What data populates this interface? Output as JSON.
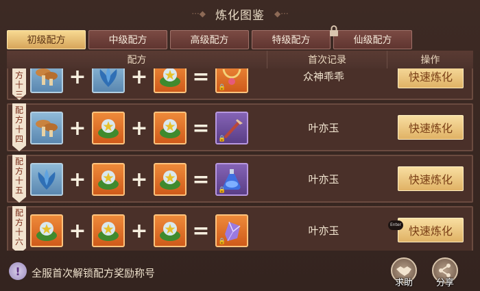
{
  "title": "炼化图鉴",
  "tabs": [
    {
      "label": "初级配方",
      "active": true,
      "locked": false
    },
    {
      "label": "中级配方",
      "active": false,
      "locked": false
    },
    {
      "label": "高级配方",
      "active": false,
      "locked": false
    },
    {
      "label": "特级配方",
      "active": false,
      "locked": false
    },
    {
      "label": "仙级配方",
      "active": false,
      "locked": true
    }
  ],
  "columns": {
    "recipe": "配方",
    "first_record": "首次记录",
    "action": "操作"
  },
  "rows": [
    {
      "ribbon": [
        "方",
        "十",
        "三"
      ],
      "items": [
        "mushroom",
        "blue-flower",
        "star-herb"
      ],
      "result": "gold-necklace",
      "record": "众神乖乖",
      "button": "快速炼化"
    },
    {
      "ribbon": [
        "配",
        "方",
        "十",
        "四"
      ],
      "items": [
        "mushroom",
        "star-herb",
        "star-herb"
      ],
      "result": "purple-weapon",
      "record": "叶亦玉",
      "button": "快速炼化"
    },
    {
      "ribbon": [
        "配",
        "方",
        "十",
        "五"
      ],
      "items": [
        "blue-flower",
        "star-herb",
        "star-herb"
      ],
      "result": "blue-potion",
      "record": "叶亦玉",
      "button": "快速炼化"
    },
    {
      "ribbon": [
        "配",
        "方",
        "十",
        "六"
      ],
      "items": [
        "star-herb",
        "star-herb",
        "star-herb"
      ],
      "result": "crystal-gem",
      "record": "叶亦玉",
      "button": "快速炼化"
    }
  ],
  "footer": {
    "notice": "全服首次解锁配方奖励称号",
    "help_label": "求助",
    "share_label": "分享"
  },
  "enter_tag": "Enter",
  "colors": {
    "accent_gold": "#e0b265",
    "panel": "#4a3029",
    "item_orange": "#cf5a1a",
    "item_blue": "#5a87b0",
    "item_purple": "#5a3e86"
  }
}
